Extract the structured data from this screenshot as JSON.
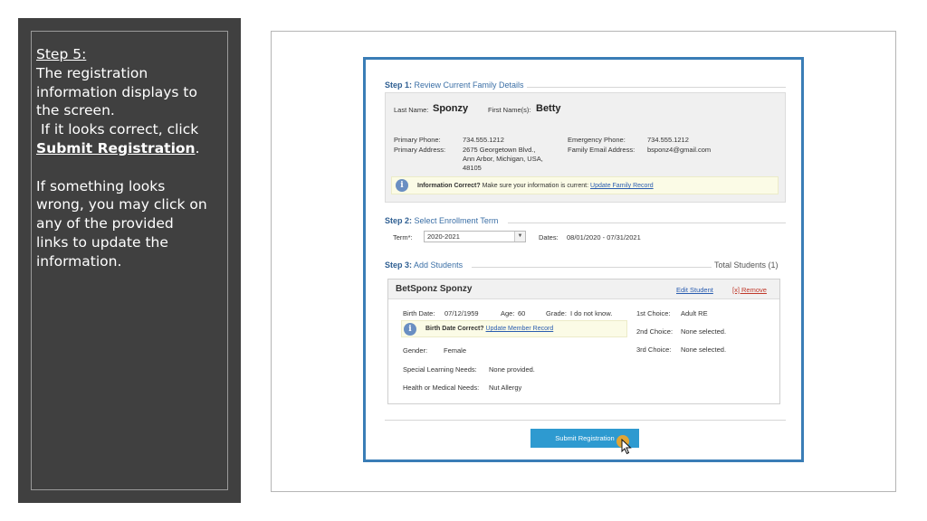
{
  "instructions": {
    "step_label": "Step 5:",
    "line1": "The registration information displays to the screen.",
    "line2": " If it looks correct, click ",
    "submit_text": "Submit Registration",
    "period": ".",
    "para2": "If something looks wrong, you may click on any of the provided links to update the information."
  },
  "step1": {
    "prefix": "Step 1:",
    "title": "Review Current Family Details",
    "last_name_label": "Last Name:",
    "last_name": "Sponzy",
    "first_name_label": "First Name(s):",
    "first_name": "Betty",
    "primary_phone_label": "Primary Phone:",
    "primary_phone": "734.555.1212",
    "primary_address_label": "Primary Address:",
    "address_line1": "2675 Georgetown Blvd.,",
    "address_line2": "Ann Arbor, Michigan, USA,",
    "address_line3": "48105",
    "emergency_phone_label": "Emergency Phone:",
    "emergency_phone": "734.555.1212",
    "family_email_label": "Family Email Address:",
    "family_email": "bsponz4@gmail.com",
    "info_bold": "Information Correct?",
    "info_text": " Make sure your information is current:",
    "info_link": "Update Family Record"
  },
  "step2": {
    "prefix": "Step 2:",
    "title": "Select Enrollment Term",
    "term_label": "Term*:",
    "term_value": "2020-2021",
    "dates_label": "Dates:",
    "dates_value": "08/01/2020 - 07/31/2021"
  },
  "step3": {
    "prefix": "Step 3:",
    "title": "Add Students",
    "total_students": "Total Students (1)",
    "student": {
      "name": "BetSponz Sponzy",
      "edit_link": "Edit Student",
      "remove_link": "[x] Remove",
      "birth_date_label": "Birth Date:",
      "birth_date": "07/12/1959",
      "age_label": "Age:",
      "age": "60",
      "grade_label": "Grade:",
      "grade": "I do not know.",
      "birth_correct_bold": "Birth Date Correct?",
      "birth_correct_link": "Update Member Record",
      "gender_label": "Gender:",
      "gender": "Female",
      "learning_label": "Special Learning Needs:",
      "learning": "None provided.",
      "health_label": "Health or Medical Needs:",
      "health": "Nut Allergy",
      "choice1_label": "1st Choice:",
      "choice1": "Adult RE",
      "choice2_label": "2nd Choice:",
      "choice2": "None selected.",
      "choice3_label": "3rd Choice:",
      "choice3": "None selected."
    }
  },
  "submit_label": "Submit Registration",
  "icons": {
    "info": "info-icon",
    "cursor": "mouse-pointer-icon",
    "dropdown": "chevron-down-icon"
  },
  "colors": {
    "panel_bg": "#404040",
    "window_border": "#3a7db6",
    "button_bg": "#2e9ad0",
    "cursor_highlight": "#f5a623"
  }
}
